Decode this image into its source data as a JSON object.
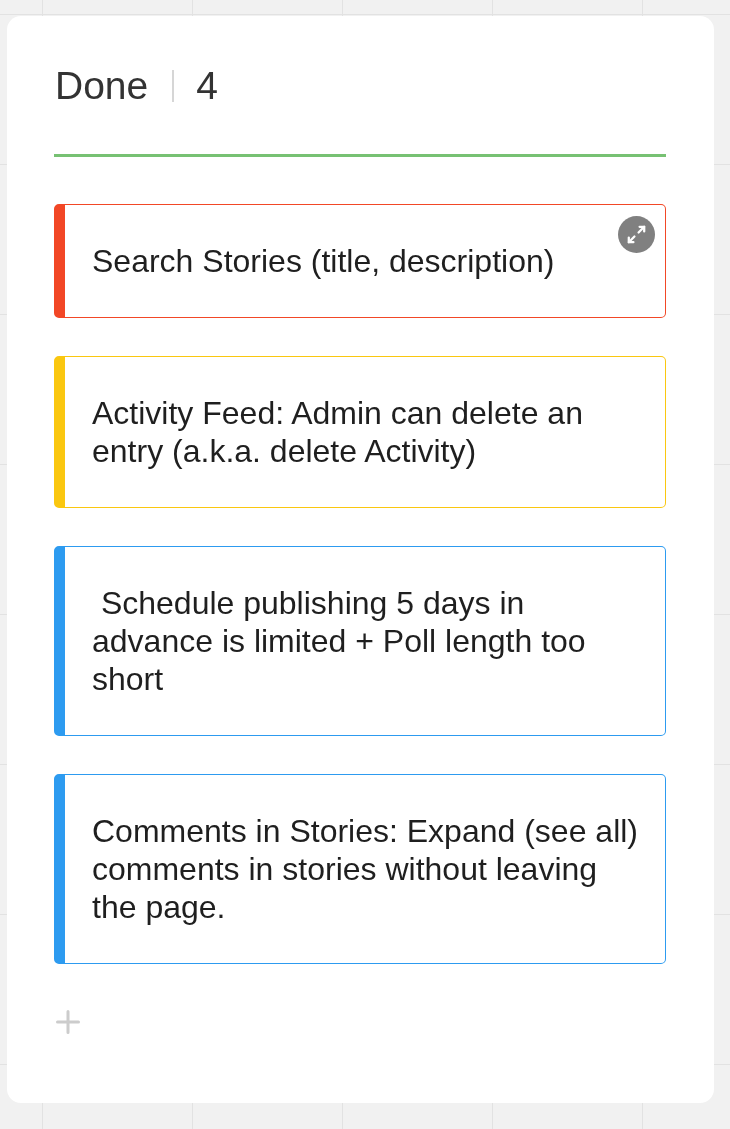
{
  "column": {
    "title": "Done",
    "count": "4"
  },
  "cards": [
    {
      "text": "Search Stories (title, description)",
      "color": "#f24726",
      "hovered": true
    },
    {
      "text": "Activity Feed: Admin can delete an entry (a.k.a. delete Activity)",
      "color": "#fac710",
      "hovered": false
    },
    {
      "text": " Schedule publishing 5 days in advance is limited + Poll length too short",
      "color": "#2d9bf0",
      "hovered": false
    },
    {
      "text": "Comments in Stories: Expand (see all) comments in stories without leaving the page.",
      "color": "#2d9bf0",
      "hovered": false
    }
  ]
}
